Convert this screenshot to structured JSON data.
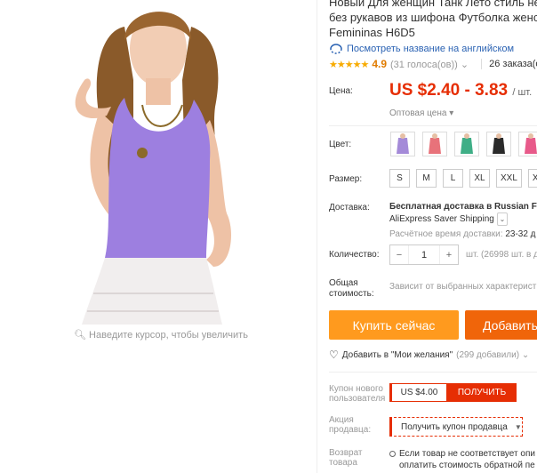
{
  "product": {
    "title_line1": "Новый Для женщин Танк Лето стиль нес",
    "title_line2": "без рукавов из шифона Футболка женска",
    "title_line3": "Femininas H6D5",
    "translate_link": "Посмотреть название на английском",
    "stars": "★★★★★",
    "rating": "4.9",
    "votes": "(31 голоса(ов)) ⌄",
    "orders": "26 заказа(ов)",
    "zoom_hint": "Наведите курсор, чтобы увеличить"
  },
  "price": {
    "label": "Цена:",
    "value": "US $2.40 - 3.83",
    "unit": "/ шт.",
    "wholesale": "Оптовая цена ▾"
  },
  "color": {
    "label": "Цвет:",
    "swatches": [
      "#a48ad8",
      "#e8727a",
      "#3fae86",
      "#2a2a2a",
      "#e85a8a"
    ]
  },
  "size": {
    "label": "Размер:",
    "options": [
      "S",
      "M",
      "L",
      "XL",
      "XXL",
      "XXXL"
    ]
  },
  "shipping": {
    "label": "Доставка:",
    "line1": "Бесплатная доставка в Russian Fe",
    "line2": "AliExpress Saver Shipping",
    "time_label": "Расчётное время доставки:",
    "time_value": "23-32 д"
  },
  "quantity": {
    "label": "Количество:",
    "minus": "−",
    "value": "1",
    "plus": "+",
    "info": "шт. (26998 шт. в до"
  },
  "total": {
    "label_line1": "Общая",
    "label_line2": "стоимость:",
    "value": "Зависит от выбранных характерист"
  },
  "buttons": {
    "buy": "Купить сейчас",
    "add": "Добавить"
  },
  "wishlist": {
    "text": "Добавить в \"Мои желания\"",
    "count": "(299 добавили) ⌄"
  },
  "coupon": {
    "label_line1": "Купон нового",
    "label_line2": "пользователя",
    "value": "US $4.00",
    "button": "ПОЛУЧИТЬ"
  },
  "promo": {
    "label_line1": "Акция",
    "label_line2": "продавца:",
    "button": "Получить купон продавца",
    "caret": "▼"
  },
  "returns": {
    "label_line1": "Возврат",
    "label_line2": "товара",
    "line1": "Если товар не соответствует опи",
    "line2": "оплатить стоимость обратной пе"
  },
  "colors": {
    "accent": "#e62e04",
    "buy": "#ff9a1e",
    "add": "#f0650a",
    "link": "#2a62b3",
    "star": "#f7ab00"
  }
}
